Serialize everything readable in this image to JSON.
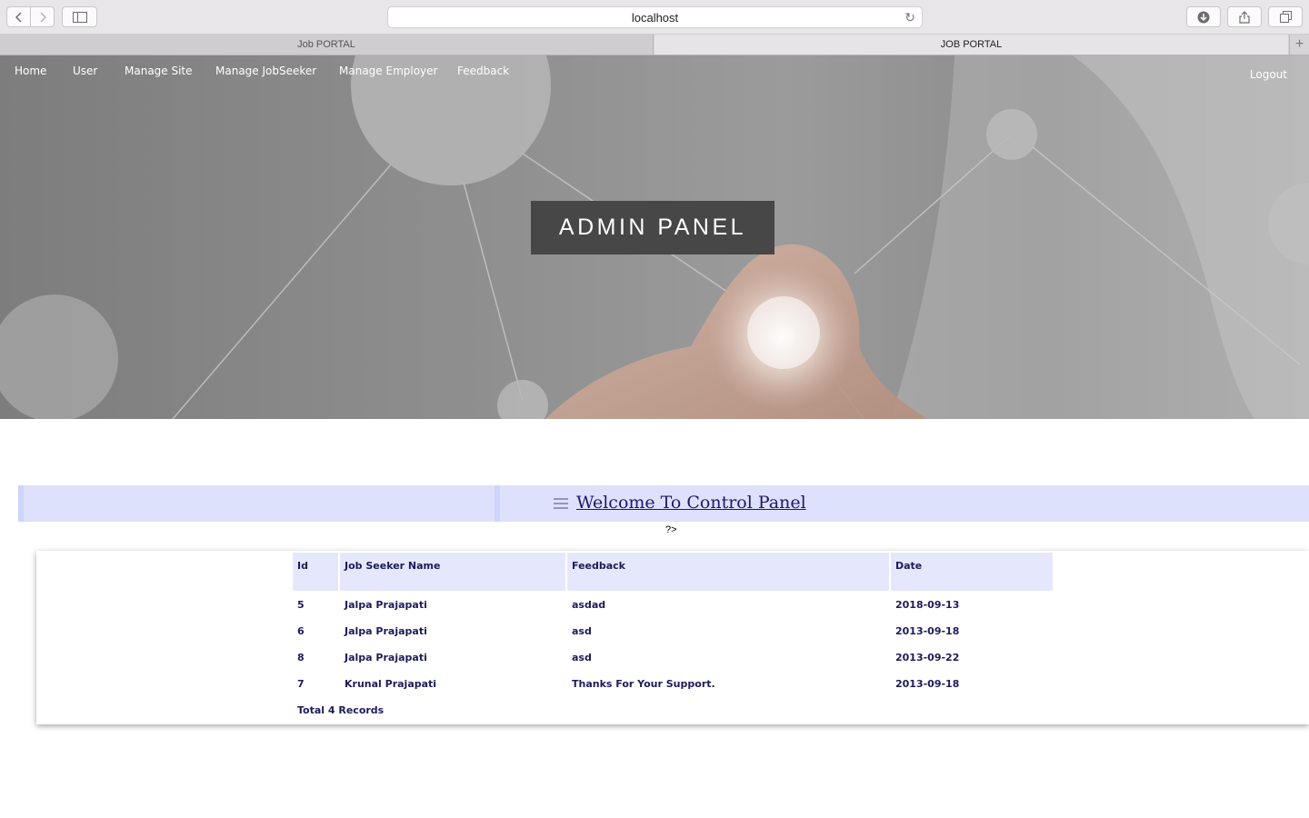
{
  "browser": {
    "address": "localhost",
    "tabs": [
      {
        "label": "Job PORTAL"
      },
      {
        "label": "JOB PORTAL"
      }
    ]
  },
  "nav": {
    "items": [
      {
        "label": "Home"
      },
      {
        "label": "User"
      },
      {
        "label": "Manage Site"
      },
      {
        "label": "Manage JobSeeker"
      },
      {
        "label": "Manage Employer"
      },
      {
        "label": "Feedback"
      }
    ],
    "logout": "Logout"
  },
  "hero": {
    "title": "ADMIN PANEL"
  },
  "welcome": {
    "title": "Welcome To Control Panel",
    "stray_text": "?>"
  },
  "table": {
    "headers": [
      "Id",
      "Job Seeker Name",
      "Feedback",
      "Date"
    ],
    "rows": [
      {
        "id": "5",
        "name": "Jalpa Prajapati",
        "feedback": "asdad",
        "date": "2018-09-13"
      },
      {
        "id": "6",
        "name": "Jalpa Prajapati",
        "feedback": "asd",
        "date": "2013-09-18"
      },
      {
        "id": "8",
        "name": "Jalpa Prajapati",
        "feedback": "asd",
        "date": "2013-09-22"
      },
      {
        "id": "7",
        "name": "Krunal Prajapati",
        "feedback": "Thanks For Your Support.",
        "date": "2013-09-18"
      }
    ],
    "total": "Total 4 Records"
  },
  "colors": {
    "hero_box": "#474747",
    "welcome_bar": "#dde1fb",
    "table_header": "#e5e8fd",
    "table_text": "#1c1c5a"
  }
}
